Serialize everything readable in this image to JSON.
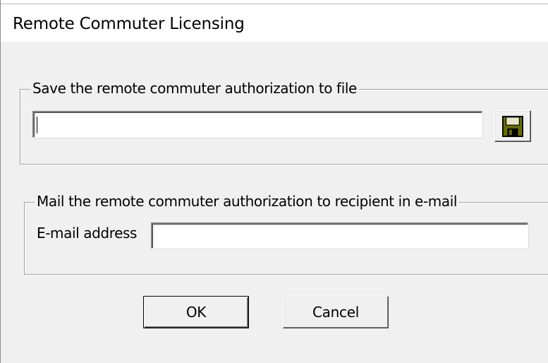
{
  "window": {
    "title": "Remote Commuter Licensing"
  },
  "save_group": {
    "legend": "Save the remote commuter authorization to file",
    "file_path_value": "",
    "save_button_icon": "floppy-disk-icon"
  },
  "mail_group": {
    "legend": "Mail the remote commuter authorization to recipient in e-mail",
    "email_label": "E-mail address",
    "email_value": ""
  },
  "buttons": {
    "ok_label": "OK",
    "cancel_label": "Cancel"
  },
  "colors": {
    "dialog_bg": "#f0f0f0",
    "titlebar_bg": "#ffffff",
    "floppy_body": "#6b6b00",
    "floppy_label": "#e6e6c8"
  }
}
